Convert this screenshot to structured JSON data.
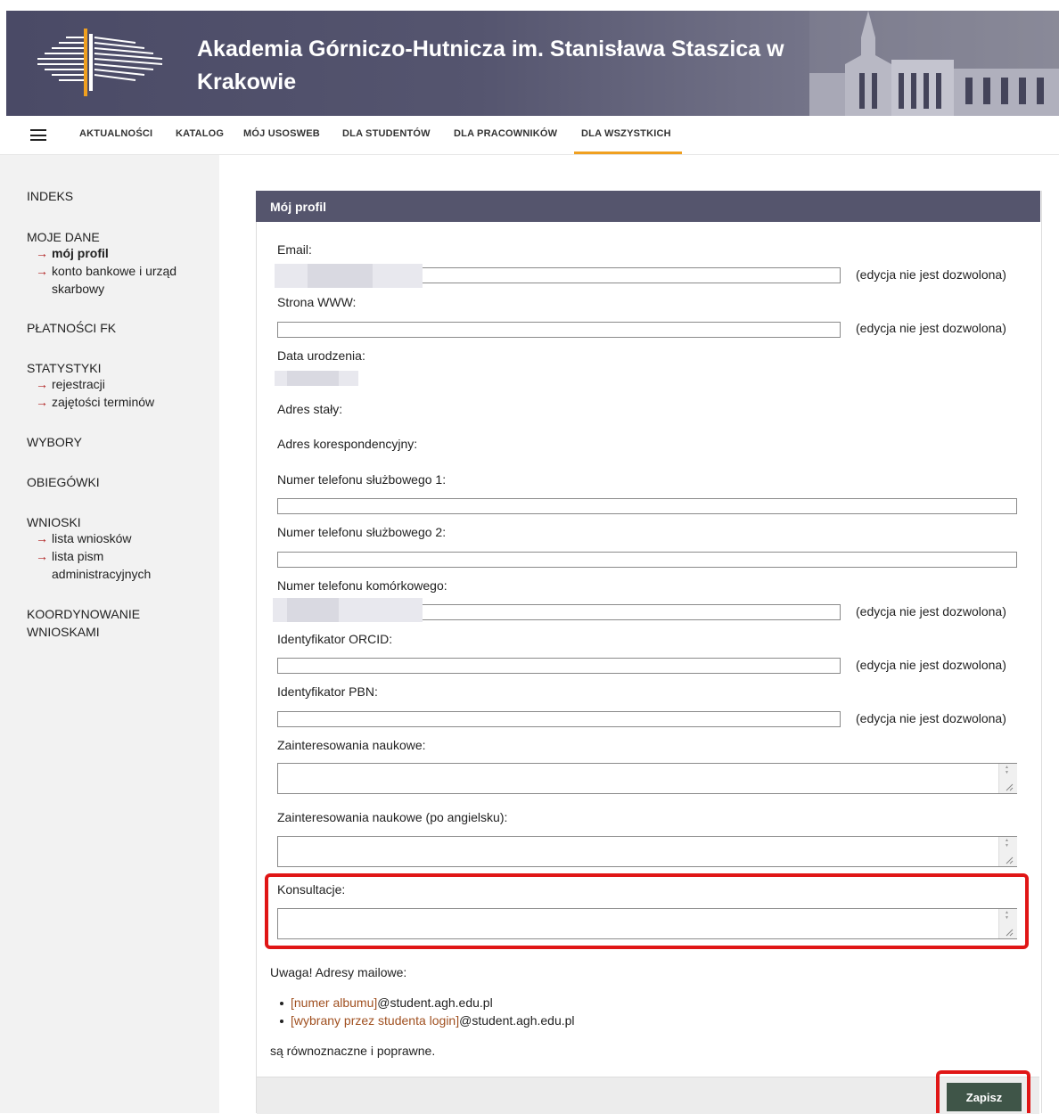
{
  "header": {
    "title": "Akademia Górniczo-Hutnicza im. Stanisława Staszica w Krakowie"
  },
  "nav": {
    "menu_icon": "hamburger-menu-icon",
    "items": [
      "AKTUALNOŚCI",
      "KATALOG",
      "MÓJ USOSWEB",
      "DLA STUDENTÓW",
      "DLA PRACOWNIKÓW",
      "DLA WSZYSTKICH"
    ],
    "active": "DLA WSZYSTKICH",
    "accent_color": "#f0a020"
  },
  "sidebar": {
    "indeks": "INDEKS",
    "moje_dane": "MOJE DANE",
    "moj_profil": "mój profil",
    "konto_1": "konto bankowe i urząd",
    "konto_2": "skarbowy",
    "platnosci": "PŁATNOŚCI FK",
    "statystyki": "STATYSTYKI",
    "rejestracji": "rejestracji",
    "zajetosci": "zajętości terminów",
    "wybory": "WYBORY",
    "obiegowki": "OBIEGÓWKI",
    "wnioski": "WNIOSKI",
    "lista_wnioskow": "lista wniosków",
    "lista_pism_1": "lista pism",
    "lista_pism_2": "administracyjnych",
    "koordynowanie_1": "KOORDYNOWANIE",
    "koordynowanie_2": "WNIOSKAMI",
    "arrow": "→"
  },
  "panel": {
    "title": "Mój profil",
    "header_color": "#55556d"
  },
  "form": {
    "email_label": "Email:",
    "www_label": "Strona WWW:",
    "birth_label": "Data urodzenia:",
    "addr_label": "Adres stały:",
    "corr_label": "Adres korespondencyjny:",
    "phone1_label": "Numer telefonu służbowego 1:",
    "phone2_label": "Numer telefonu służbowego 2:",
    "mobile_label": "Numer telefonu komórkowego:",
    "orcid_label": "Identyfikator ORCID:",
    "pbn_label": "Identyfikator PBN:",
    "interests_label": "Zainteresowania naukowe:",
    "interests_en_label": "Zainteresowania naukowe (po angielsku):",
    "consult_label": "Konsultacje:",
    "readonly_note": "(edycja nie jest dozwolona)"
  },
  "info": {
    "warning": "Uwaga! Adresy mailowe:",
    "b1_link": "[numer albumu]",
    "b1_rest": "@student.agh.edu.pl",
    "b2_link": "[wybrany przez studenta login]",
    "b2_rest": "@student.agh.edu.pl",
    "tail": "są równoznaczne i poprawne."
  },
  "actions": {
    "save": "Zapisz",
    "save_color": "#3f5548",
    "highlight_color": "#e01616"
  }
}
